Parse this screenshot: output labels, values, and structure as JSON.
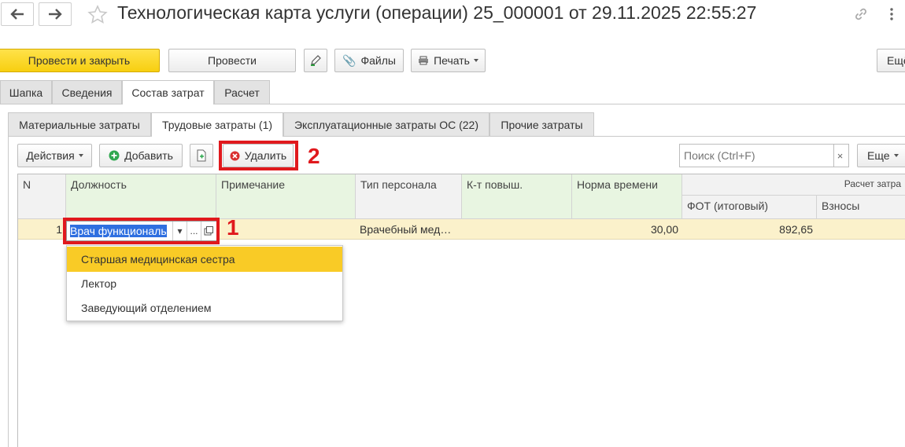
{
  "window": {
    "title": "Технологическая карта услуги (операции) 25_000001 от 29.11.2025 22:55:27",
    "back_icon": "arrow-left-icon",
    "forward_icon": "arrow-right-icon",
    "favorite_icon": "star-icon",
    "link_icon": "link-icon",
    "more_icon": "vertical-dots-icon"
  },
  "toolbar": {
    "post_close_label": "Провести и закрыть",
    "post_label": "Провести",
    "files_label": "Файлы",
    "print_label": "Печать",
    "more_label": "Ещё",
    "accent_color": "#f7cf10"
  },
  "tabs": [
    "Шапка",
    "Сведения",
    "Состав затрат",
    "Расчет"
  ],
  "active_tab": "Состав затрат",
  "subtabs": [
    "Материальные затраты",
    "Трудовые затраты (1)",
    "Эксплуатационные затраты ОС (22)",
    "Прочие затраты"
  ],
  "active_subtab": "Трудовые затраты (1)",
  "table_toolbar": {
    "actions_label": "Действия",
    "add_label": "Добавить",
    "delete_label": "Удалить",
    "search_placeholder": "Поиск (Ctrl+F)",
    "search_clear": "×",
    "more_label": "Еще"
  },
  "table": {
    "headers": {
      "n": "N",
      "position": "Должность",
      "note": "Примечание",
      "staff_type": "Тип персонала",
      "coef": "К-т повыш.",
      "time_norm": "Норма времени",
      "group": "Расчет затра",
      "fot": "ФОТ (итоговый)",
      "contrib": "Взносы"
    },
    "rows": [
      {
        "n": "1",
        "position": "Врач функциональ",
        "note": "",
        "staff_type": "Врачебный мед…",
        "coef": "",
        "time_norm": "30,00",
        "fot": "892,65",
        "contrib": ""
      }
    ]
  },
  "edit_field": {
    "dropdown_button": "▾",
    "select_button": "...",
    "open_icon": "open-form-icon"
  },
  "dropdown_options": [
    "Старшая медицинская сестра",
    "Лектор",
    "Заведующий отделением"
  ],
  "highlighted_option": "Старшая медицинская сестра",
  "annotations": {
    "label_1": "1",
    "label_2": "2",
    "color": "#e0191d"
  }
}
